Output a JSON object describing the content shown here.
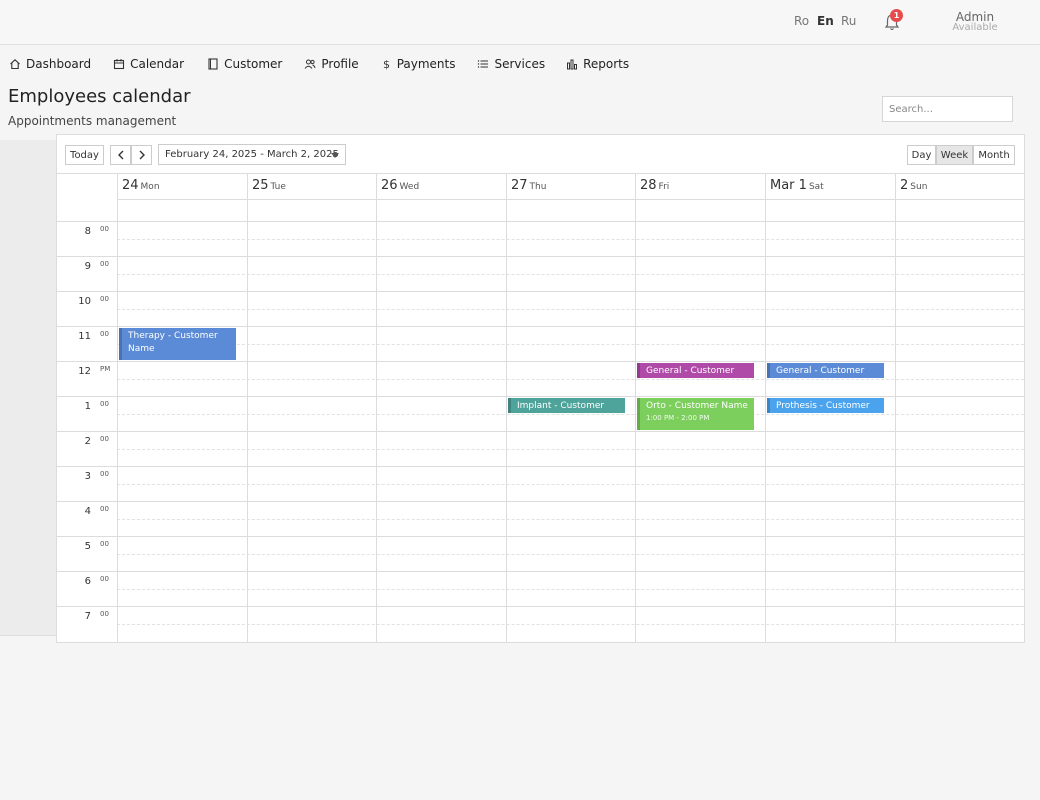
{
  "languages": [
    {
      "label": "Ro",
      "active": false
    },
    {
      "label": "En",
      "active": true
    },
    {
      "label": "Ru",
      "active": false
    }
  ],
  "notifications": {
    "count": "1"
  },
  "user": {
    "name": "Admin",
    "status": "Available"
  },
  "nav": [
    {
      "label": "Dashboard",
      "icon": "home-icon"
    },
    {
      "label": "Calendar",
      "icon": "calendar-icon"
    },
    {
      "label": "Customer",
      "icon": "book-icon"
    },
    {
      "label": "Profile",
      "icon": "users-icon"
    },
    {
      "label": "Payments",
      "icon": "dollar-icon"
    },
    {
      "label": "Services",
      "icon": "list-icon"
    },
    {
      "label": "Reports",
      "icon": "bar-chart-icon"
    }
  ],
  "page": {
    "title": "Employees calendar",
    "subtitle": "Appointments management"
  },
  "search": {
    "placeholder": "Search..."
  },
  "toolbar": {
    "today": "Today",
    "date_range": "February 24, 2025 - March 2, 2025",
    "views": [
      {
        "label": "Day",
        "active": false
      },
      {
        "label": "Week",
        "active": true
      },
      {
        "label": "Month",
        "active": false
      }
    ]
  },
  "days": [
    {
      "num": "24",
      "name": "Mon"
    },
    {
      "num": "25",
      "name": "Tue"
    },
    {
      "num": "26",
      "name": "Wed"
    },
    {
      "num": "27",
      "name": "Thu"
    },
    {
      "num": "28",
      "name": "Fri"
    },
    {
      "num": "Mar 1",
      "name": "Sat"
    },
    {
      "num": "2",
      "name": "Sun"
    }
  ],
  "hours": [
    {
      "hour": "8",
      "min": "00"
    },
    {
      "hour": "9",
      "min": "00"
    },
    {
      "hour": "10",
      "min": "00"
    },
    {
      "hour": "11",
      "min": "00"
    },
    {
      "hour": "12",
      "min": "PM"
    },
    {
      "hour": "1",
      "min": "00"
    },
    {
      "hour": "2",
      "min": "00"
    },
    {
      "hour": "3",
      "min": "00"
    },
    {
      "hour": "4",
      "min": "00"
    },
    {
      "hour": "5",
      "min": "00"
    },
    {
      "hour": "6",
      "min": "00"
    },
    {
      "hour": "7",
      "min": "00"
    }
  ],
  "events": [
    {
      "title": "Therapy - Customer Name",
      "time": "",
      "day": 0,
      "start": 11,
      "end": 12,
      "color": "#5b8bd6"
    },
    {
      "title": "General - Customer",
      "time": "",
      "day": 4,
      "start": 12,
      "end": 12.5,
      "color": "#b04aa9"
    },
    {
      "title": "General - Customer",
      "time": "",
      "day": 5,
      "start": 12,
      "end": 12.5,
      "color": "#5b8bd6"
    },
    {
      "title": "Implant - Customer",
      "time": "",
      "day": 3,
      "start": 13,
      "end": 13.5,
      "color": "#4ea39a"
    },
    {
      "title": "Orto - Customer Name",
      "time": "1:00 PM - 2:00 PM",
      "day": 4,
      "start": 13,
      "end": 14,
      "color": "#7ccf5c"
    },
    {
      "title": "Prothesis - Customer",
      "time": "",
      "day": 5,
      "start": 13,
      "end": 13.5,
      "color": "#4aa3ec"
    }
  ]
}
